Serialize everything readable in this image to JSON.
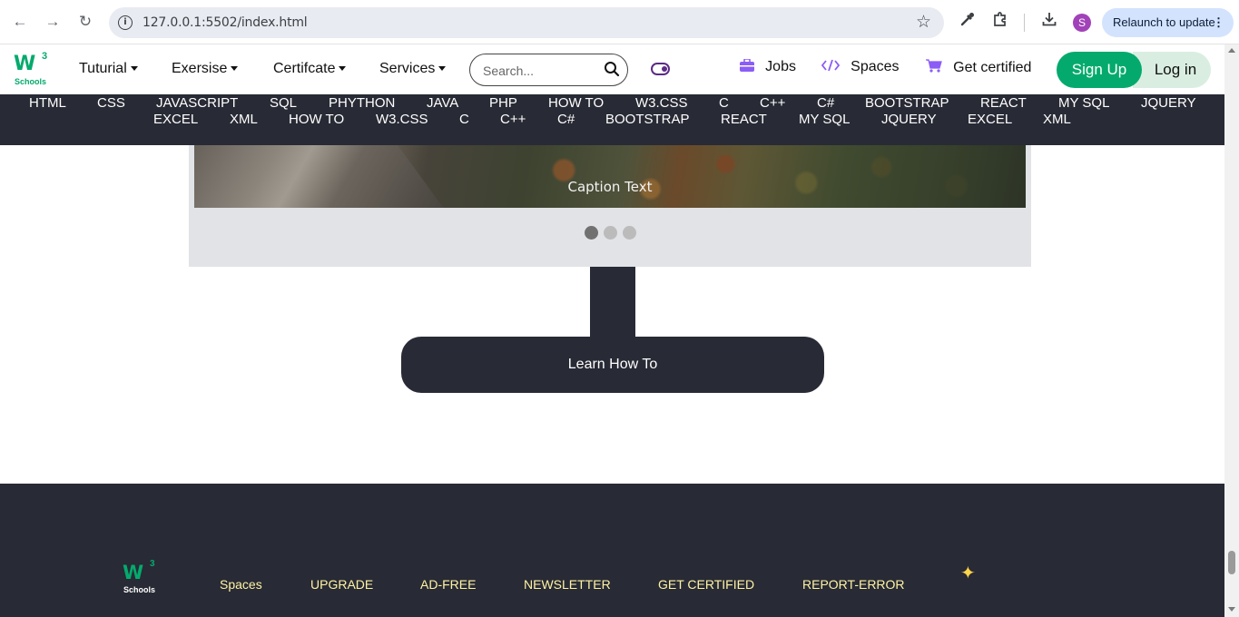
{
  "browser": {
    "url": "127.0.0.1:5502/index.html",
    "profile_initial": "S",
    "relaunch_label": "Relaunch to update",
    "kebab": "⋮"
  },
  "header": {
    "logo": {
      "mark": "W",
      "superscript": "3",
      "wordmark": "Schools"
    },
    "menus": [
      {
        "label": "Tuturial"
      },
      {
        "label": "Exersise"
      },
      {
        "label": "Certifcate"
      },
      {
        "label": "Services"
      }
    ],
    "search": {
      "placeholder": "Search..."
    },
    "links": [
      {
        "label": "Jobs",
        "icon": "briefcase-icon"
      },
      {
        "label": "Spaces",
        "icon": "code-icon"
      },
      {
        "label": "Get certified",
        "icon": "cart-icon"
      }
    ],
    "signup_label": "Sign Up",
    "login_label": "Log in"
  },
  "topics": {
    "row1": [
      "HTML",
      "CSS",
      "JAVASCRIPT",
      "SQL",
      "PHYTHON",
      "JAVA",
      "PHP",
      "HOW TO",
      "W3.CSS",
      "C",
      "C++",
      "C#",
      "BOOTSTRAP",
      "REACT",
      "MY SQL",
      "JQUERY"
    ],
    "row2": [
      "EXCEL",
      "XML",
      "HOW TO",
      "W3.CSS",
      "C",
      "C++",
      "C#",
      "BOOTSTRAP",
      "REACT",
      "MY SQL",
      "JQUERY",
      "EXCEL",
      "XML"
    ]
  },
  "slideshow": {
    "caption": "Caption Text",
    "slide_count": 3,
    "active_slide": 1
  },
  "learn_button_label": "Learn How To",
  "footer": {
    "logo": {
      "mark": "W",
      "superscript": "3",
      "wordmark": "Schools"
    },
    "links": [
      "Spaces",
      "UPGRADE",
      "AD-FREE",
      "NEWSLETTER",
      "GET CERTIFIED",
      "REPORT-ERROR"
    ],
    "sparkle": "✦"
  },
  "colors": {
    "brand_green": "#04aa6d",
    "dark": "#282a35",
    "footer_link": "#fff4a3",
    "accent_purple": "#8b5cf6"
  }
}
